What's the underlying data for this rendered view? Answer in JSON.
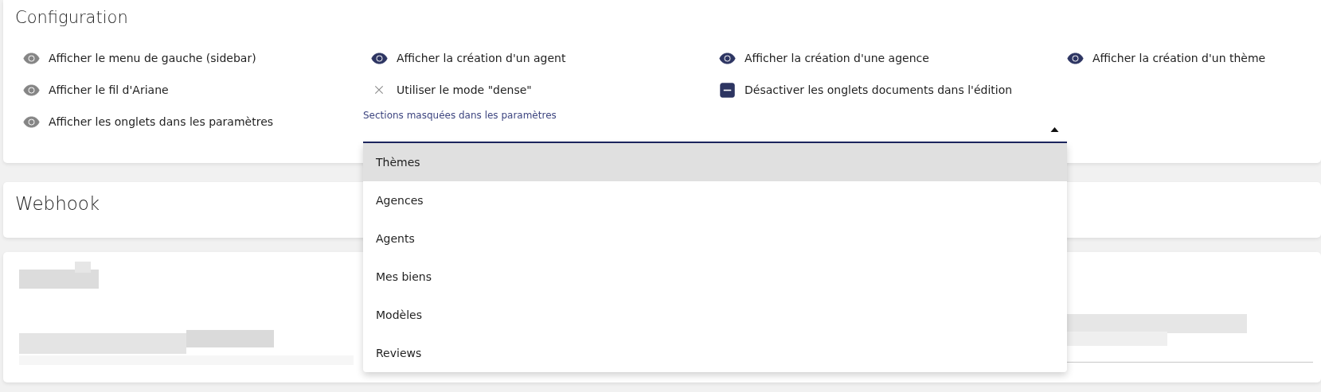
{
  "configuration": {
    "title": "Configuration",
    "options": [
      {
        "label": "Afficher le menu de gauche (sidebar)",
        "kind": "eye",
        "on": false
      },
      {
        "label": "Afficher la création d'un agent",
        "kind": "eye",
        "on": true
      },
      {
        "label": "Afficher la création d'une agence",
        "kind": "eye",
        "on": true
      },
      {
        "label": "Afficher la création d'un thème",
        "kind": "eye",
        "on": true
      },
      {
        "label": "Afficher le fil d'Ariane",
        "kind": "eye",
        "on": false
      },
      {
        "label": "Utiliser le mode \"dense\"",
        "kind": "cross",
        "on": false
      },
      {
        "label": "Désactiver les onglets documents dans l'édition",
        "kind": "checkbox",
        "on": true
      },
      {
        "label": "Afficher les onglets dans les paramètres",
        "kind": "eye",
        "on": false
      }
    ],
    "hidden_sections": {
      "label": "Sections masquées dans les paramètres",
      "expanded": true,
      "options": [
        {
          "label": "Thèmes",
          "selected": true
        },
        {
          "label": "Agences",
          "selected": false
        },
        {
          "label": "Agents",
          "selected": false
        },
        {
          "label": "Mes biens",
          "selected": false
        },
        {
          "label": "Modèles",
          "selected": false
        },
        {
          "label": "Reviews",
          "selected": false
        }
      ]
    }
  },
  "webhook": {
    "title": "Webhook"
  }
}
